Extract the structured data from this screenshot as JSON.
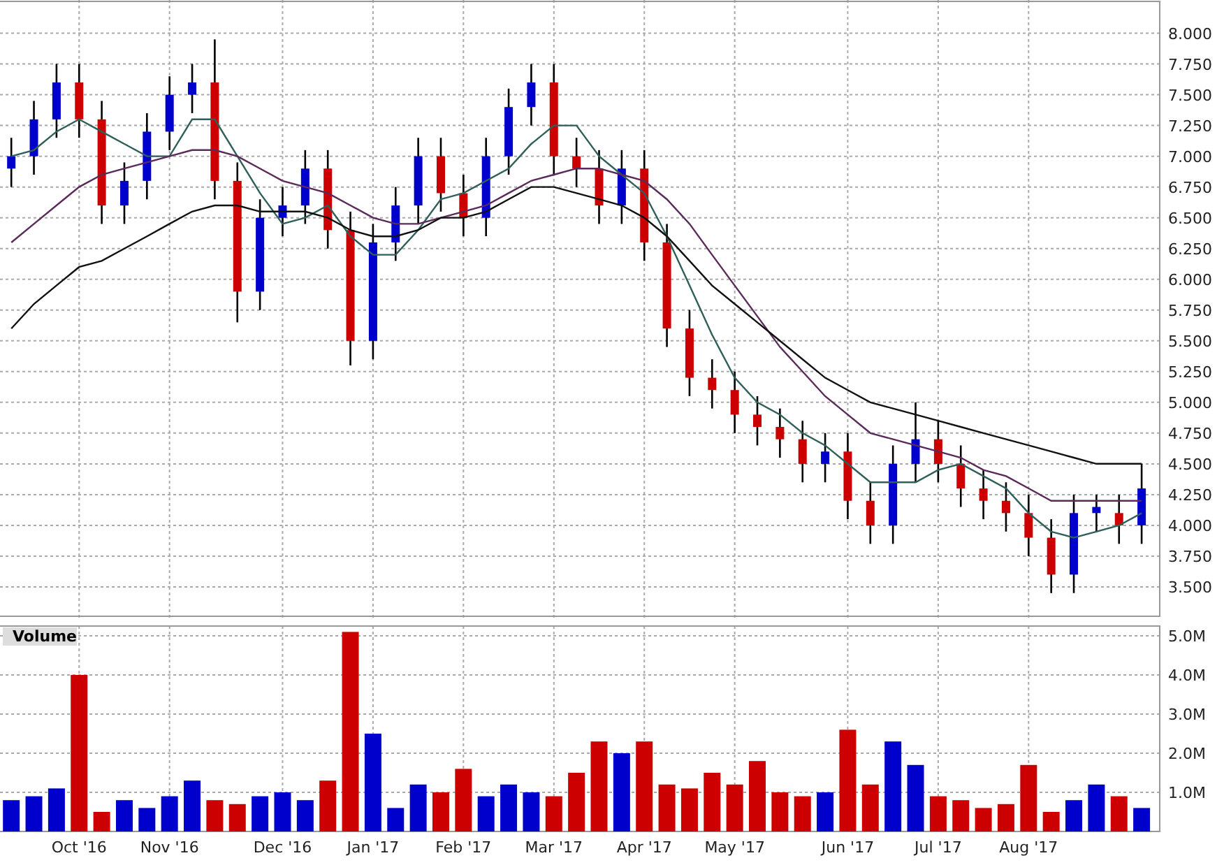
{
  "price_chart": {
    "chart_data": {
      "type": "candlestick",
      "grid": true,
      "categories": [
        null,
        null,
        null,
        null,
        null,
        null,
        null,
        null,
        null,
        null,
        null,
        null,
        null,
        null,
        null,
        null,
        null,
        null,
        null,
        null,
        null,
        null,
        null,
        null,
        null,
        null,
        null,
        null,
        null,
        null,
        null,
        null,
        null,
        null,
        null,
        null,
        null,
        null,
        null,
        null,
        null,
        null,
        null,
        null,
        null,
        null,
        null,
        null,
        null,
        null,
        null
      ],
      "ylim": [
        3.25,
        8.27
      ],
      "yticks": [
        {
          "value": 3.5,
          "label": "3.500"
        },
        {
          "value": 3.75,
          "label": "3.750"
        },
        {
          "value": 4,
          "label": "4.000"
        },
        {
          "value": 4.25,
          "label": "4.250"
        },
        {
          "value": 4.5,
          "label": "4.500"
        },
        {
          "value": 4.75,
          "label": "4.750"
        },
        {
          "value": 5,
          "label": "5.000"
        },
        {
          "value": 5.25,
          "label": "5.250"
        },
        {
          "value": 5.5,
          "label": "5.500"
        },
        {
          "value": 5.75,
          "label": "5.750"
        },
        {
          "value": 6,
          "label": "6.000"
        },
        {
          "value": 6.25,
          "label": "6.250"
        },
        {
          "value": 6.5,
          "label": "6.500"
        },
        {
          "value": 6.75,
          "label": "6.750"
        },
        {
          "value": 7,
          "label": "7.000"
        },
        {
          "value": 7.25,
          "label": "7.250"
        },
        {
          "value": 7.5,
          "label": "7.500"
        },
        {
          "value": 7.75,
          "label": "7.750"
        },
        {
          "value": 8,
          "label": "8.000"
        }
      ],
      "ohlc": [
        [
          6.9,
          7.15,
          6.75,
          7.0
        ],
        [
          7.0,
          7.45,
          6.85,
          7.3
        ],
        [
          7.3,
          7.75,
          7.15,
          7.6
        ],
        [
          7.6,
          7.75,
          7.15,
          7.3
        ],
        [
          7.3,
          7.45,
          6.45,
          6.6
        ],
        [
          6.6,
          6.95,
          6.45,
          6.8
        ],
        [
          6.8,
          7.35,
          6.65,
          7.2
        ],
        [
          7.2,
          7.65,
          7.05,
          7.5
        ],
        [
          7.5,
          7.75,
          7.35,
          7.6
        ],
        [
          7.6,
          7.95,
          6.65,
          6.8
        ],
        [
          6.8,
          6.95,
          5.65,
          5.9
        ],
        [
          5.9,
          6.65,
          5.75,
          6.5
        ],
        [
          6.5,
          6.75,
          6.35,
          6.6
        ],
        [
          6.6,
          7.05,
          6.45,
          6.9
        ],
        [
          6.9,
          7.05,
          6.25,
          6.4
        ],
        [
          6.4,
          6.55,
          5.3,
          5.5
        ],
        [
          5.5,
          6.45,
          5.35,
          6.3
        ],
        [
          6.3,
          6.75,
          6.15,
          6.6
        ],
        [
          6.6,
          7.15,
          6.45,
          7.0
        ],
        [
          7.0,
          7.15,
          6.55,
          6.7
        ],
        [
          6.7,
          6.85,
          6.35,
          6.5
        ],
        [
          6.5,
          7.15,
          6.35,
          7.0
        ],
        [
          7.0,
          7.55,
          6.85,
          7.4
        ],
        [
          7.4,
          7.75,
          7.25,
          7.6
        ],
        [
          7.6,
          7.75,
          6.85,
          7.0
        ],
        [
          7.0,
          7.15,
          6.75,
          6.9
        ],
        [
          6.9,
          7.05,
          6.45,
          6.6
        ],
        [
          6.6,
          7.05,
          6.45,
          6.9
        ],
        [
          6.9,
          7.05,
          6.15,
          6.3
        ],
        [
          6.3,
          6.45,
          5.45,
          5.6
        ],
        [
          5.6,
          5.75,
          5.05,
          5.2
        ],
        [
          5.2,
          5.35,
          4.95,
          5.1
        ],
        [
          5.1,
          5.25,
          4.75,
          4.9
        ],
        [
          4.9,
          5.05,
          4.65,
          4.8
        ],
        [
          4.8,
          4.95,
          4.55,
          4.7
        ],
        [
          4.7,
          4.85,
          4.35,
          4.5
        ],
        [
          4.5,
          4.75,
          4.35,
          4.6
        ],
        [
          4.6,
          4.75,
          4.05,
          4.2
        ],
        [
          4.2,
          4.35,
          3.85,
          4.0
        ],
        [
          4.0,
          4.65,
          3.85,
          4.5
        ],
        [
          4.5,
          5.0,
          4.35,
          4.7
        ],
        [
          4.7,
          4.85,
          4.35,
          4.5
        ],
        [
          4.5,
          4.65,
          4.15,
          4.3
        ],
        [
          4.3,
          4.45,
          4.05,
          4.2
        ],
        [
          4.2,
          4.35,
          3.95,
          4.1
        ],
        [
          4.1,
          4.25,
          3.75,
          3.9
        ],
        [
          3.9,
          4.05,
          3.45,
          3.6
        ],
        [
          3.6,
          4.25,
          3.45,
          4.1
        ],
        [
          4.1,
          4.25,
          3.95,
          4.15
        ],
        [
          4.1,
          4.25,
          3.85,
          4.0
        ],
        [
          4.0,
          4.5,
          3.85,
          4.3
        ]
      ],
      "series": [
        {
          "type": "line",
          "color": "#2f5f5a",
          "values": [
            7.0,
            7.05,
            7.2,
            7.3,
            7.2,
            7.1,
            7.0,
            7.0,
            7.3,
            7.3,
            7.0,
            6.7,
            6.45,
            6.5,
            6.6,
            6.35,
            6.2,
            6.2,
            6.4,
            6.65,
            6.7,
            6.8,
            6.9,
            7.1,
            7.25,
            7.25,
            7.0,
            6.85,
            6.7,
            6.35,
            5.95,
            5.55,
            5.2,
            5.0,
            4.9,
            4.75,
            4.65,
            4.5,
            4.35,
            4.35,
            4.35,
            4.45,
            4.5,
            4.4,
            4.3,
            4.1,
            3.95,
            3.9,
            3.95,
            4.0,
            4.1
          ]
        },
        {
          "type": "line",
          "color": "#5a2a5a",
          "values": [
            6.3,
            6.45,
            6.6,
            6.75,
            6.85,
            6.9,
            6.95,
            7.0,
            7.05,
            7.05,
            7.0,
            6.9,
            6.8,
            6.75,
            6.7,
            6.6,
            6.5,
            6.45,
            6.45,
            6.5,
            6.55,
            6.6,
            6.7,
            6.8,
            6.85,
            6.9,
            6.9,
            6.85,
            6.8,
            6.65,
            6.45,
            6.2,
            5.95,
            5.7,
            5.45,
            5.25,
            5.05,
            4.9,
            4.75,
            4.7,
            4.65,
            4.6,
            4.55,
            4.45,
            4.4,
            4.3,
            4.2,
            4.2,
            4.2,
            4.2,
            4.2
          ]
        },
        {
          "type": "line",
          "color": "#111111",
          "values": [
            5.6,
            5.8,
            5.95,
            6.1,
            6.15,
            6.25,
            6.35,
            6.45,
            6.55,
            6.6,
            6.6,
            6.55,
            6.55,
            6.55,
            6.5,
            6.4,
            6.35,
            6.35,
            6.4,
            6.5,
            6.5,
            6.55,
            6.65,
            6.75,
            6.75,
            6.7,
            6.65,
            6.6,
            6.5,
            6.35,
            6.15,
            5.95,
            5.8,
            5.65,
            5.5,
            5.35,
            5.2,
            5.1,
            5.0,
            4.95,
            4.9,
            4.85,
            4.8,
            4.75,
            4.7,
            4.65,
            4.6,
            4.55,
            4.5,
            4.5,
            4.5
          ]
        }
      ]
    }
  },
  "volume_chart": {
    "title": "Volume",
    "chart_data": {
      "type": "bar",
      "grid": true,
      "categories": [
        null,
        null,
        null,
        "Oct '16",
        null,
        null,
        null,
        "Nov '16",
        null,
        null,
        null,
        null,
        "Dec '16",
        null,
        null,
        null,
        "Jan '17",
        null,
        null,
        null,
        "Feb '17",
        null,
        null,
        null,
        "Mar '17",
        null,
        null,
        null,
        "Apr '17",
        null,
        null,
        null,
        "May '17",
        null,
        null,
        null,
        null,
        "Jun '17",
        null,
        null,
        null,
        "Jul '17",
        null,
        null,
        null,
        "Aug '17",
        null,
        null,
        null,
        null,
        null
      ],
      "ylim": [
        0,
        5.25
      ],
      "yticks": [
        {
          "value": 1,
          "label": "1.0M"
        },
        {
          "value": 2,
          "label": "2.0M"
        },
        {
          "value": 3,
          "label": "3.0M"
        },
        {
          "value": 4,
          "label": "4.0M"
        },
        {
          "value": 5,
          "label": "5.0M"
        }
      ],
      "values": [
        0.8,
        0.9,
        1.1,
        4.0,
        0.5,
        0.8,
        0.6,
        0.9,
        1.3,
        0.8,
        0.7,
        0.9,
        1.0,
        0.8,
        1.3,
        5.1,
        2.5,
        0.6,
        1.2,
        1.0,
        1.6,
        0.9,
        1.2,
        1.0,
        0.9,
        1.5,
        2.3,
        2.0,
        2.3,
        1.2,
        1.1,
        1.5,
        1.2,
        1.8,
        1.0,
        0.9,
        1.0,
        2.6,
        1.2,
        2.3,
        1.7,
        0.9,
        0.8,
        0.6,
        0.7,
        1.7,
        0.5,
        0.8,
        1.2,
        0.9,
        0.6
      ]
    }
  }
}
